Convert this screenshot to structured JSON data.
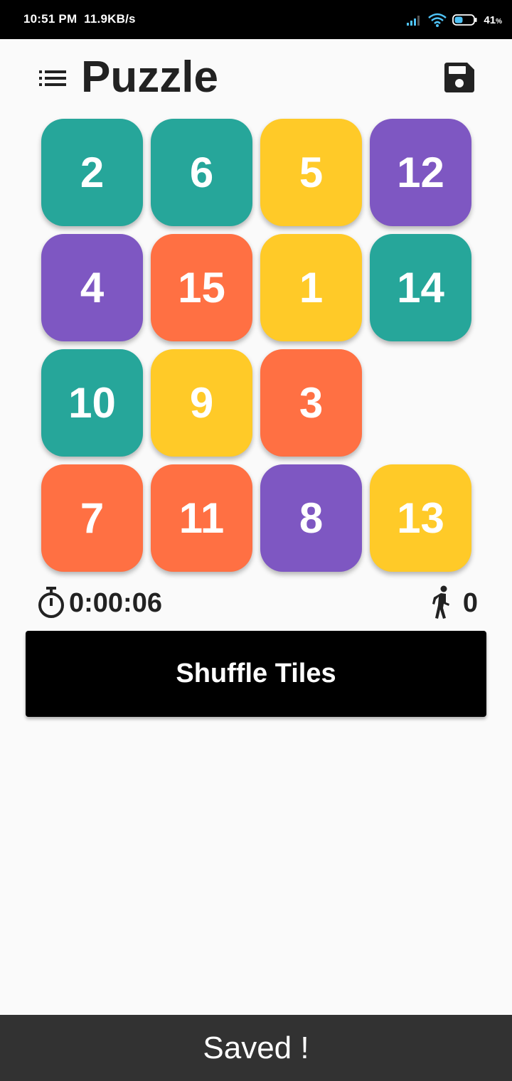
{
  "status_bar": {
    "time": "10:51 PM",
    "net_speed": "11.9KB/s",
    "battery_percent": "41",
    "battery_unit": "%",
    "icons": [
      "signal-icon",
      "wifi-icon",
      "battery-icon"
    ]
  },
  "header": {
    "title": "Puzzle",
    "menu_icon": "list-menu-icon",
    "save_icon": "floppy-disk-icon"
  },
  "board": {
    "rows": 4,
    "cols": 4,
    "empty": [
      2,
      3
    ],
    "tiles": [
      {
        "label": "2",
        "row": 0,
        "col": 0,
        "color": "#26a69a"
      },
      {
        "label": "6",
        "row": 0,
        "col": 1,
        "color": "#26a69a"
      },
      {
        "label": "5",
        "row": 0,
        "col": 2,
        "color": "#ffca28"
      },
      {
        "label": "12",
        "row": 0,
        "col": 3,
        "color": "#7e57c2"
      },
      {
        "label": "4",
        "row": 1,
        "col": 0,
        "color": "#7e57c2"
      },
      {
        "label": "15",
        "row": 1,
        "col": 1,
        "color": "#ff7043"
      },
      {
        "label": "1",
        "row": 1,
        "col": 2,
        "color": "#ffca28"
      },
      {
        "label": "14",
        "row": 1,
        "col": 3,
        "color": "#26a69a"
      },
      {
        "label": "10",
        "row": 2,
        "col": 0,
        "color": "#26a69a"
      },
      {
        "label": "9",
        "row": 2,
        "col": 1,
        "color": "#ffca28"
      },
      {
        "label": "3",
        "row": 2,
        "col": 2,
        "color": "#ff7043"
      },
      {
        "label": "7",
        "row": 3,
        "col": 0,
        "color": "#ff7043"
      },
      {
        "label": "11",
        "row": 3,
        "col": 1,
        "color": "#ff7043"
      },
      {
        "label": "8",
        "row": 3,
        "col": 2,
        "color": "#7e57c2"
      },
      {
        "label": "13",
        "row": 3,
        "col": 3,
        "color": "#ffca28"
      }
    ]
  },
  "stats": {
    "timer_icon": "stopwatch-icon",
    "elapsed": "0:00:06",
    "moves_icon": "walking-person-icon",
    "moves": "0"
  },
  "actions": {
    "shuffle_label": "Shuffle Tiles"
  },
  "snackbar": {
    "message": "Saved !"
  }
}
